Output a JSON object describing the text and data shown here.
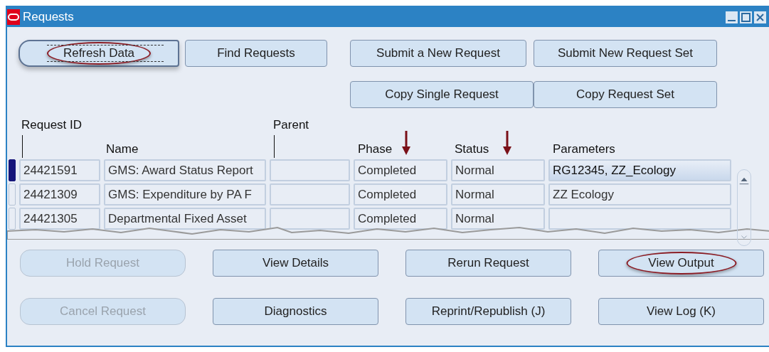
{
  "window": {
    "title": "Requests"
  },
  "top_buttons": [
    {
      "label": "Refresh Data",
      "focused": true,
      "highlighted": true,
      "disabled": false
    },
    {
      "label": "Find Requests",
      "focused": false,
      "highlighted": false,
      "disabled": false
    },
    {
      "label": "Submit a New Request",
      "focused": false,
      "highlighted": false,
      "disabled": false
    },
    {
      "label": "Submit New Request Set",
      "focused": false,
      "highlighted": false,
      "disabled": false
    },
    {
      "label": "Copy Single Request",
      "focused": false,
      "highlighted": false,
      "disabled": false
    },
    {
      "label": "Copy Request Set",
      "focused": false,
      "highlighted": false,
      "disabled": false
    }
  ],
  "table": {
    "columns": [
      {
        "label": "Request ID",
        "arrow": false
      },
      {
        "label": "Name",
        "arrow": false
      },
      {
        "label": "Parent",
        "arrow": false
      },
      {
        "label": "Phase",
        "arrow": true
      },
      {
        "label": "Status",
        "arrow": true
      },
      {
        "label": "Parameters",
        "arrow": false
      }
    ],
    "rows": [
      {
        "selected": true,
        "cells": [
          "24421591",
          "GMS: Award Status Report",
          "",
          "Completed",
          "Normal",
          "RG12345, ZZ_Ecology"
        ]
      },
      {
        "selected": false,
        "cells": [
          "24421309",
          "GMS: Expenditure by PA F",
          "",
          "Completed",
          "Normal",
          "ZZ Ecology"
        ]
      },
      {
        "selected": false,
        "cells": [
          "24421305",
          "Departmental Fixed Asset",
          "",
          "Completed",
          "Normal",
          ""
        ]
      }
    ]
  },
  "bottom_buttons": [
    {
      "label": "Hold Request",
      "focused": false,
      "highlighted": false,
      "disabled": true
    },
    {
      "label": "View Details",
      "focused": false,
      "highlighted": false,
      "disabled": false
    },
    {
      "label": "Rerun Request",
      "focused": false,
      "highlighted": false,
      "disabled": false
    },
    {
      "label": "View Output",
      "focused": false,
      "highlighted": true,
      "disabled": false
    },
    {
      "label": "Cancel Request",
      "focused": false,
      "highlighted": false,
      "disabled": true
    },
    {
      "label": "Diagnostics",
      "focused": false,
      "highlighted": false,
      "disabled": false
    },
    {
      "label": "Reprint/Republish (J)",
      "focused": false,
      "highlighted": false,
      "disabled": false
    },
    {
      "label": "View Log (K)",
      "focused": false,
      "highlighted": false,
      "disabled": false
    }
  ]
}
